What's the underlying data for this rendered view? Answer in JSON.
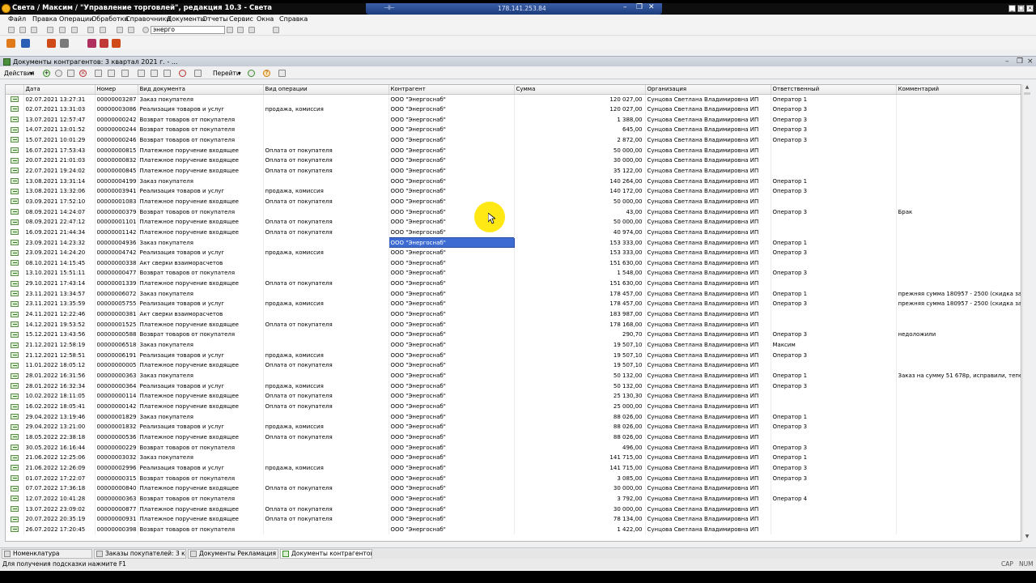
{
  "window": {
    "title": "Света / Максим / \"Управление торговлей\", редакция 10.3 - Света",
    "remote_ip": "178.141.253.84"
  },
  "menu": [
    "Файл",
    "Правка",
    "Операции",
    "Обработки",
    "Справочники",
    "Документы",
    "Отчеты",
    "Сервис",
    "Окна",
    "Справка"
  ],
  "toolbar": {
    "search_value": "энерго"
  },
  "doc": {
    "title": "Документы контрагентов: 3 квартал 2021 г. - ...",
    "actions_label": "Действия",
    "goto_label": "Перейти"
  },
  "table": {
    "columns": [
      "Дата",
      "Номер",
      "Вид документа",
      "Вид операции",
      "Контрагент",
      "Сумма",
      "Организация",
      "Ответственный",
      "Комментарий"
    ],
    "rows": [
      [
        "02.07.2021 13:27:31",
        "00000003287",
        "Заказ покупателя",
        "",
        "ООО \"Энергоснаб\"",
        "120 027,00",
        "Сунцова Светлана Владимировна ИП",
        "Оператор 1",
        ""
      ],
      [
        "02.07.2021 13:31:03",
        "00000003086",
        "Реализация товаров и услуг",
        "продажа, комиссия",
        "ООО \"Энергоснаб\"",
        "120 027,00",
        "Сунцова Светлана Владимировна ИП",
        "Оператор 3",
        ""
      ],
      [
        "13.07.2021 12:57:47",
        "00000000242",
        "Возврат товаров от покупателя",
        "",
        "ООО \"Энергоснаб\"",
        "1 388,00",
        "Сунцова Светлана Владимировна ИП",
        "Оператор 3",
        ""
      ],
      [
        "14.07.2021 13:01:52",
        "00000000244",
        "Возврат товаров от покупателя",
        "",
        "ООО \"Энергоснаб\"",
        "645,00",
        "Сунцова Светлана Владимировна ИП",
        "Оператор 3",
        ""
      ],
      [
        "15.07.2021 10:01:29",
        "00000000246",
        "Возврат товаров от покупателя",
        "",
        "ООО \"Энергоснаб\"",
        "2 872,00",
        "Сунцова Светлана Владимировна ИП",
        "Оператор 3",
        ""
      ],
      [
        "16.07.2021 17:53:43",
        "00000000815",
        "Платежное поручение входящее",
        "Оплата от покупателя",
        "ООО \"Энергоснаб\"",
        "50 000,00",
        "Сунцова Светлана Владимировна ИП",
        "",
        ""
      ],
      [
        "20.07.2021 21:01:03",
        "00000000832",
        "Платежное поручение входящее",
        "Оплата от покупателя",
        "ООО \"Энергоснаб\"",
        "30 000,00",
        "Сунцова Светлана Владимировна ИП",
        "",
        ""
      ],
      [
        "22.07.2021 19:24:02",
        "00000000845",
        "Платежное поручение входящее",
        "Оплата от покупателя",
        "ООО \"Энергоснаб\"",
        "35 122,00",
        "Сунцова Светлана Владимировна ИП",
        "",
        ""
      ],
      [
        "13.08.2021 13:31:14",
        "00000004199",
        "Заказ покупателя",
        "",
        "ООО \"Энергоснаб\"",
        "140 264,00",
        "Сунцова Светлана Владимировна ИП",
        "Оператор 1",
        ""
      ],
      [
        "13.08.2021 13:32:06",
        "00000003941",
        "Реализация товаров и услуг",
        "продажа, комиссия",
        "ООО \"Энергоснаб\"",
        "140 172,00",
        "Сунцова Светлана Владимировна ИП",
        "Оператор 3",
        ""
      ],
      [
        "03.09.2021 17:52:10",
        "00000001083",
        "Платежное поручение входящее",
        "Оплата от покупателя",
        "ООО \"Энергоснаб\"",
        "50 000,00",
        "Сунцова Светлана Владимировна ИП",
        "",
        ""
      ],
      [
        "08.09.2021 14:24:07",
        "00000000379",
        "Возврат товаров от покупателя",
        "",
        "ООО \"Энергоснаб\"",
        "43,00",
        "Сунцова Светлана Владимировна ИП",
        "Оператор 3",
        "Брак"
      ],
      [
        "08.09.2021 22:47:12",
        "00000001101",
        "Платежное поручение входящее",
        "Оплата от покупателя",
        "ООО \"Энергоснаб\"",
        "50 000,00",
        "Сунцова Светлана Владимировна ИП",
        "",
        ""
      ],
      [
        "16.09.2021 21:44:34",
        "00000001142",
        "Платежное поручение входящее",
        "Оплата от покупателя",
        "ООО \"Энергоснаб\"",
        "40 974,00",
        "Сунцова Светлана Владимировна ИП",
        "",
        ""
      ],
      [
        "23.09.2021 14:23:32",
        "00000004936",
        "Заказ покупателя",
        "",
        "ООО \"Энергоснаб\"",
        "153 333,00",
        "Сунцова Светлана Владимировна ИП",
        "Оператор 1",
        ""
      ],
      [
        "23.09.2021 14:24:20",
        "00000004742",
        "Реализация товаров и услуг",
        "продажа, комиссия",
        "ООО \"Энергоснаб\"",
        "153 333,00",
        "Сунцова Светлана Владимировна ИП",
        "Оператор 3",
        ""
      ],
      [
        "08.10.2021 14:15:45",
        "00000000338",
        "Акт сверки взаиморасчетов",
        "",
        "ООО \"Энергоснаб\"",
        "151 630,00",
        "Сунцова Светлана Владимировна ИП",
        "",
        ""
      ],
      [
        "13.10.2021 15:51:11",
        "00000000477",
        "Возврат товаров от покупателя",
        "",
        "ООО \"Энергоснаб\"",
        "1 548,00",
        "Сунцова Светлана Владимировна ИП",
        "Оператор 3",
        ""
      ],
      [
        "29.10.2021 17:43:14",
        "00000001339",
        "Платежное поручение входящее",
        "Оплата от покупателя",
        "ООО \"Энергоснаб\"",
        "151 630,00",
        "Сунцова Светлана Владимировна ИП",
        "",
        ""
      ],
      [
        "23.11.2021 13:34:57",
        "00000006072",
        "Заказ покупателя",
        "",
        "ООО \"Энергоснаб\"",
        "178 457,00",
        "Сунцова Светлана Владимировна ИП",
        "Оператор 1",
        "прежняя сумма 180957 - 2500 (скидка за б..."
      ],
      [
        "23.11.2021 13:35:59",
        "00000005755",
        "Реализация товаров и услуг",
        "продажа, комиссия",
        "ООО \"Энергоснаб\"",
        "178 457,00",
        "Сунцова Светлана Владимировна ИП",
        "Оператор 3",
        "прежняя сумма 180957 - 2500 (скидка за б..."
      ],
      [
        "24.11.2021 12:22:46",
        "00000000381",
        "Акт сверки взаиморасчетов",
        "",
        "ООО \"Энергоснаб\"",
        "183 987,00",
        "Сунцова Светлана Владимировна ИП",
        "",
        ""
      ],
      [
        "14.12.2021 19:53:52",
        "00000001525",
        "Платежное поручение входящее",
        "Оплата от покупателя",
        "ООО \"Энергоснаб\"",
        "178 168,00",
        "Сунцова Светлана Владимировна ИП",
        "",
        ""
      ],
      [
        "15.12.2021 13:43:56",
        "00000000588",
        "Возврат товаров от покупателя",
        "",
        "ООО \"Энергоснаб\"",
        "290,70",
        "Сунцова Светлана Владимировна ИП",
        "Оператор 3",
        "недоложили"
      ],
      [
        "21.12.2021 12:58:19",
        "00000006518",
        "Заказ покупателя",
        "",
        "ООО \"Энергоснаб\"",
        "19 507,10",
        "Сунцова Светлана Владимировна ИП",
        "Максим",
        ""
      ],
      [
        "21.12.2021 12:58:51",
        "00000006191",
        "Реализация товаров и услуг",
        "продажа, комиссия",
        "ООО \"Энергоснаб\"",
        "19 507,10",
        "Сунцова Светлана Владимировна ИП",
        "Оператор 3",
        ""
      ],
      [
        "11.01.2022 18:05:12",
        "00000000005",
        "Платежное поручение входящее",
        "Оплата от покупателя",
        "ООО \"Энергоснаб\"",
        "19 507,10",
        "Сунцова Светлана Владимировна ИП",
        "",
        ""
      ],
      [
        "28.01.2022 16:31:56",
        "00000000363",
        "Заказ покупателя",
        "",
        "ООО \"Энергоснаб\"",
        "50 132,00",
        "Сунцова Светлана Владимировна ИП",
        "Оператор 1",
        "Заказ на сумму 51 678р, исправили, тепер..."
      ],
      [
        "28.01.2022 16:32:34",
        "00000000364",
        "Реализация товаров и услуг",
        "продажа, комиссия",
        "ООО \"Энергоснаб\"",
        "50 132,00",
        "Сунцова Светлана Владимировна ИП",
        "Оператор 3",
        ""
      ],
      [
        "10.02.2022 18:11:05",
        "00000000114",
        "Платежное поручение входящее",
        "Оплата от покупателя",
        "ООО \"Энергоснаб\"",
        "25 130,30",
        "Сунцова Светлана Владимировна ИП",
        "",
        ""
      ],
      [
        "16.02.2022 18:05:41",
        "00000000142",
        "Платежное поручение входящее",
        "Оплата от покупателя",
        "ООО \"Энергоснаб\"",
        "25 000,00",
        "Сунцова Светлана Владимировна ИП",
        "",
        ""
      ],
      [
        "29.04.2022 13:19:46",
        "00000001829",
        "Заказ покупателя",
        "",
        "ООО \"Энергоснаб\"",
        "88 026,00",
        "Сунцова Светлана Владимировна ИП",
        "Оператор 1",
        ""
      ],
      [
        "29.04.2022 13:21:00",
        "00000001832",
        "Реализация товаров и услуг",
        "продажа, комиссия",
        "ООО \"Энергоснаб\"",
        "88 026,00",
        "Сунцова Светлана Владимировна ИП",
        "Оператор 3",
        ""
      ],
      [
        "18.05.2022 22:38:18",
        "00000000536",
        "Платежное поручение входящее",
        "Оплата от покупателя",
        "ООО \"Энергоснаб\"",
        "88 026,00",
        "Сунцова Светлана Владимировна ИП",
        "",
        ""
      ],
      [
        "30.05.2022 16:16:44",
        "00000000229",
        "Возврат товаров от покупателя",
        "",
        "ООО \"Энергоснаб\"",
        "496,00",
        "Сунцова Светлана Владимировна ИП",
        "Оператор 3",
        ""
      ],
      [
        "21.06.2022 12:25:06",
        "00000003032",
        "Заказ покупателя",
        "",
        "ООО \"Энергоснаб\"",
        "141 715,00",
        "Сунцова Светлана Владимировна ИП",
        "Оператор 1",
        ""
      ],
      [
        "21.06.2022 12:26:09",
        "00000002996",
        "Реализация товаров и услуг",
        "продажа, комиссия",
        "ООО \"Энергоснаб\"",
        "141 715,00",
        "Сунцова Светлана Владимировна ИП",
        "Оператор 3",
        ""
      ],
      [
        "01.07.2022 17:22:07",
        "00000000315",
        "Возврат товаров от покупателя",
        "",
        "ООО \"Энергоснаб\"",
        "3 085,00",
        "Сунцова Светлана Владимировна ИП",
        "Оператор 3",
        ""
      ],
      [
        "07.07.2022 17:36:18",
        "00000000840",
        "Платежное поручение входящее",
        "Оплата от покупателя",
        "ООО \"Энергоснаб\"",
        "30 000,00",
        "Сунцова Светлана Владимировна ИП",
        "",
        ""
      ],
      [
        "12.07.2022 10:41:28",
        "00000000363",
        "Возврат товаров от покупателя",
        "",
        "ООО \"Энергоснаб\"",
        "3 792,00",
        "Сунцова Светлана Владимировна ИП",
        "Оператор 4",
        ""
      ],
      [
        "13.07.2022 23:09:02",
        "00000000877",
        "Платежное поручение входящее",
        "Оплата от покупателя",
        "ООО \"Энергоснаб\"",
        "30 000,00",
        "Сунцова Светлана Владимировна ИП",
        "",
        ""
      ],
      [
        "20.07.2022 20:35:19",
        "00000000931",
        "Платежное поручение входящее",
        "Оплата от покупателя",
        "ООО \"Энергоснаб\"",
        "78 134,00",
        "Сунцова Светлана Владимировна ИП",
        "",
        ""
      ],
      [
        "26.07.2022 17:20:45",
        "00000000398",
        "Возврат товаров от покупателя",
        "",
        "ООО \"Энергоснаб\"",
        "1 422,00",
        "Сунцова Светлана Владимировна ИП",
        "",
        ""
      ]
    ],
    "selected_row": 14,
    "selected_col": 4
  },
  "tasks": [
    "Номенклатура",
    "Заказы покупателей: 3 ква...",
    "Документы Рекламация",
    "Документы контрагентов: 3..."
  ],
  "status": {
    "hint": "Для получения подсказки нажмите F1",
    "cap": "CAP",
    "num": "NUM"
  }
}
